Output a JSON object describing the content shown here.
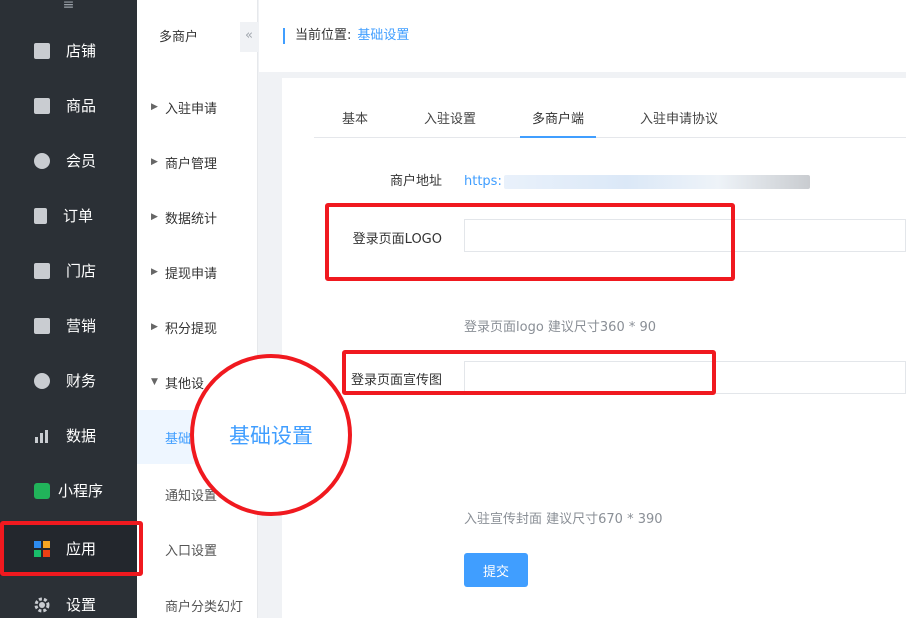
{
  "nav": {
    "collapse_icon": "≡",
    "items": [
      {
        "label": "店铺",
        "icon": "store-icon"
      },
      {
        "label": "商品",
        "icon": "goods-icon"
      },
      {
        "label": "会员",
        "icon": "user-icon"
      },
      {
        "label": "订单",
        "icon": "order-icon"
      },
      {
        "label": "门店",
        "icon": "shop-icon"
      },
      {
        "label": "营销",
        "icon": "gift-icon"
      },
      {
        "label": "财务",
        "icon": "money-bag-icon"
      },
      {
        "label": "数据",
        "icon": "bar-chart-icon"
      },
      {
        "label": "小程序",
        "icon": "miniprogram-icon"
      },
      {
        "label": "应用",
        "icon": "apps-icon"
      },
      {
        "label": "设置",
        "icon": "gear-icon"
      }
    ]
  },
  "submenu": {
    "title": "多商户",
    "items": [
      {
        "label": "入驻申请"
      },
      {
        "label": "商户管理"
      },
      {
        "label": "数据统计"
      },
      {
        "label": "提现申请"
      },
      {
        "label": "积分提现"
      },
      {
        "label": "其他设"
      }
    ],
    "children": [
      {
        "label": "基础"
      },
      {
        "label": "通知设置"
      },
      {
        "label": "入口设置"
      },
      {
        "label": "商户分类幻灯"
      }
    ],
    "collapse_icon": "«"
  },
  "breadcrumb": {
    "prefix": "当前位置:",
    "current": "基础设置"
  },
  "tabs": [
    {
      "label": "基本"
    },
    {
      "label": "入驻设置"
    },
    {
      "label": "多商户端"
    },
    {
      "label": "入驻申请协议"
    }
  ],
  "form": {
    "address_label": "商户地址",
    "address_value": "https:",
    "logo_label": "登录页面LOGO",
    "logo_hint": "登录页面logo 建议尺寸360 * 90",
    "banner_label": "登录页面宣传图",
    "banner_hint": "入驻宣传封面 建议尺寸670 * 390",
    "submit_label": "提交"
  },
  "callout": {
    "text": "基础设置"
  },
  "colors": {
    "accent": "#409eff",
    "annotation": "#f0191f",
    "nav_bg": "#2b3036"
  }
}
